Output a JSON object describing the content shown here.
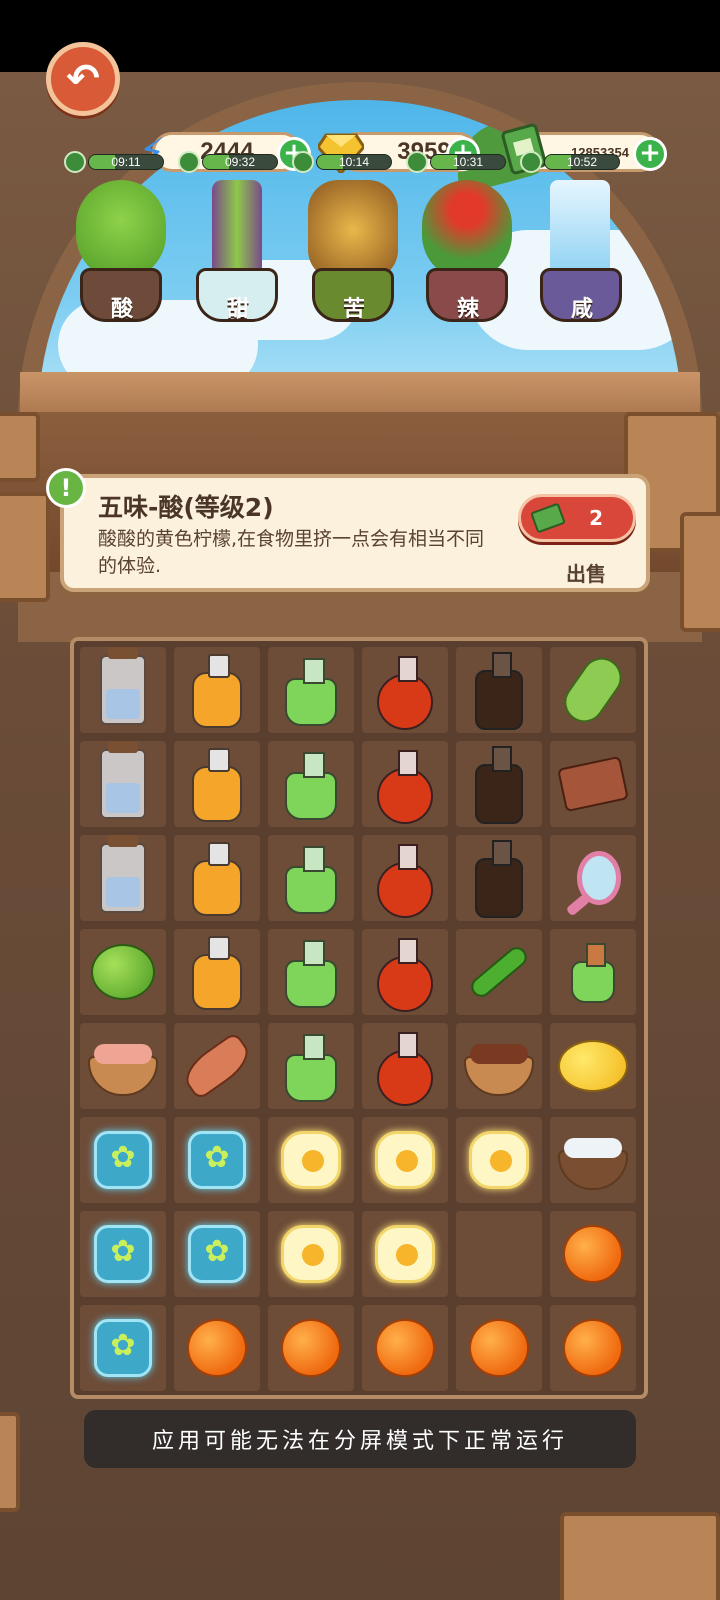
{
  "resources": {
    "energy": "2444",
    "gems": "3959",
    "cash": "12853354"
  },
  "timers": [
    "09:11",
    "09:32",
    "10:14",
    "10:31",
    "10:52"
  ],
  "plants": [
    {
      "label": "酸"
    },
    {
      "label": "甜"
    },
    {
      "label": "苦"
    },
    {
      "label": "辣"
    },
    {
      "label": "咸"
    }
  ],
  "info": {
    "title": "五味-酸(等级2)",
    "description": "酸酸的黄色柠檬,在食物里挤一点会有相当不同的体验.",
    "sell_price": "2",
    "sell_label": "出售"
  },
  "toast": "应用可能无法在分屏模式下正常运行",
  "colors": {
    "accent_red": "#d9473b",
    "plus_green": "#3bb34a",
    "panel_bg": "#fbf1dc"
  }
}
